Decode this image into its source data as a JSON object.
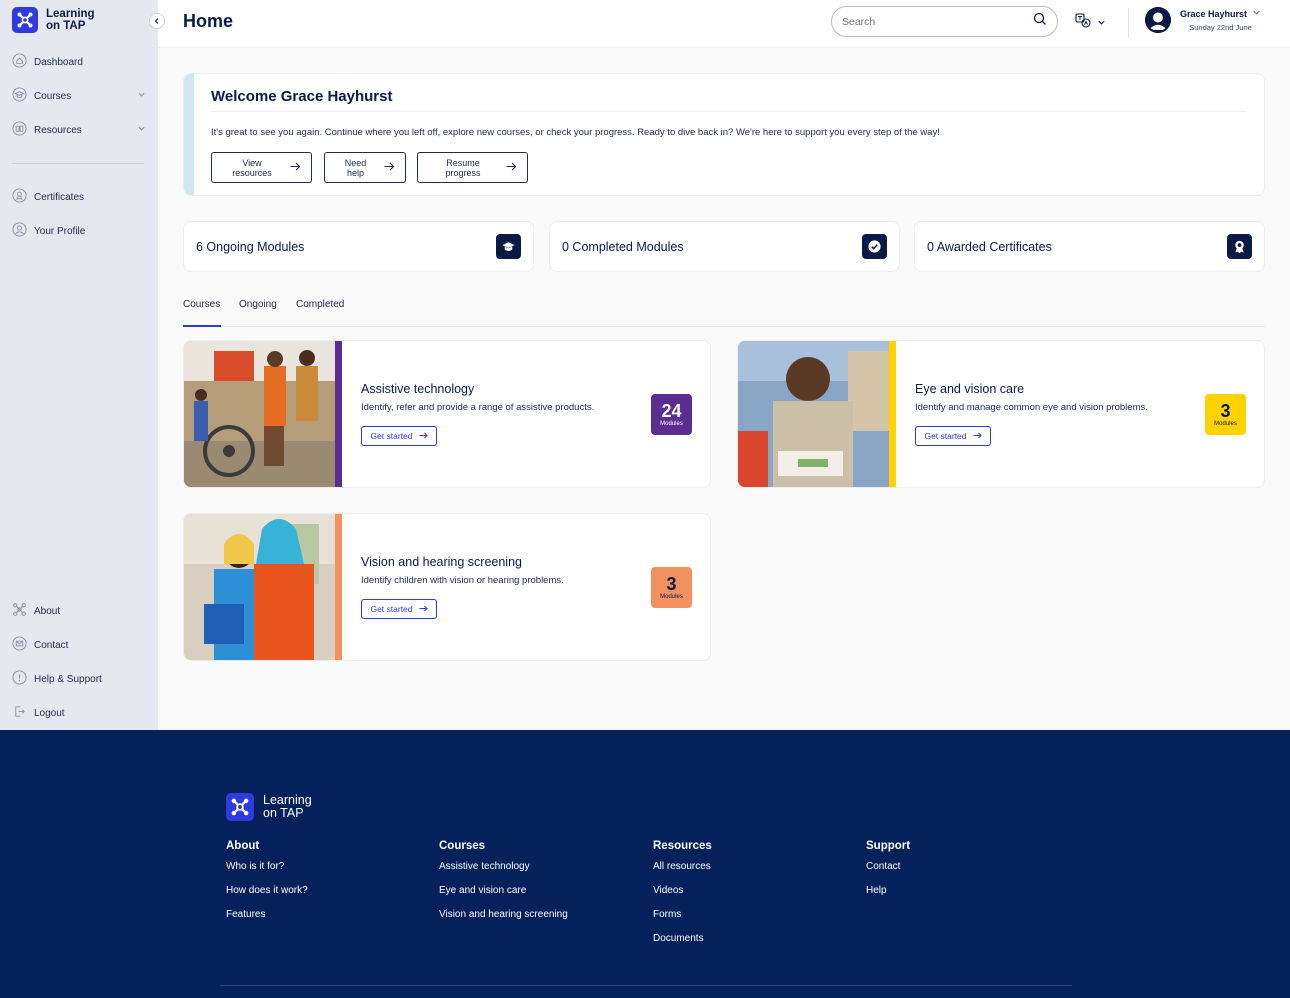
{
  "app": {
    "name_line1": "Learning",
    "name_line2": "on TAP"
  },
  "sidebar": {
    "top_items": [
      {
        "label": "Dashboard",
        "icon": "home-icon"
      },
      {
        "label": "Courses",
        "icon": "graduation-cap-icon"
      },
      {
        "label": "Resources",
        "icon": "book-icon"
      }
    ],
    "mid_items": [
      {
        "label": "Certificates",
        "icon": "award-icon"
      },
      {
        "label": "Your Profile",
        "icon": "user-circle-icon"
      }
    ],
    "bottom_items": [
      {
        "label": "About",
        "icon": "logo-icon"
      },
      {
        "label": "Contact",
        "icon": "mail-icon"
      },
      {
        "label": "Help & Support",
        "icon": "help-icon"
      },
      {
        "label": "Logout",
        "icon": "logout-icon"
      }
    ]
  },
  "header": {
    "title": "Home",
    "search_placeholder": "Search",
    "user_name": "Grace Hayhurst",
    "user_date": "Sunday 22nd June"
  },
  "welcome": {
    "title": "Welcome Grace Hayhurst",
    "message": "It's great to see you again. Continue where you left off, explore new courses, or check your progress. Ready to dive back in? We're here to support you every step of the way!",
    "buttons": [
      "View resources",
      "Need help",
      "Resume progress"
    ]
  },
  "stats": [
    {
      "label": "6 Ongoing Modules",
      "icon": "graduation-cap-icon"
    },
    {
      "label": "0 Completed Modules",
      "icon": "check-circle-icon"
    },
    {
      "label": "0 Awarded Certificates",
      "icon": "award-icon"
    }
  ],
  "tabs": [
    "Courses",
    "Ongoing",
    "Completed"
  ],
  "active_tab": "Courses",
  "courses": [
    {
      "title": "Assistive technology",
      "description": "Identify, refer and provide a range of assistive products.",
      "modules": "24",
      "modules_label": "Modules",
      "cta": "Get started",
      "accent": "#5c2d91",
      "badge_bg": "#5c2d91",
      "badge_fg": "#ffffff"
    },
    {
      "title": "Eye and vision care",
      "description": "Identify and manage common eye and vision problems.",
      "modules": "3",
      "modules_label": "Modules",
      "cta": "Get started",
      "accent": "#ffd200",
      "badge_bg": "#ffd200",
      "badge_fg": "#0b1a45"
    },
    {
      "title": "Vision and hearing screening",
      "description": "Identify children with vision or hearing problems.",
      "modules": "3",
      "modules_label": "Modules",
      "cta": "Get started",
      "accent": "#f29160",
      "badge_bg": "#f29160",
      "badge_fg": "#0b1a45"
    }
  ],
  "footer": {
    "columns": [
      {
        "heading": "About",
        "links": [
          "Who is it for?",
          "How does it work?",
          "Features"
        ]
      },
      {
        "heading": "Courses",
        "links": [
          "Assistive technology",
          "Eye and vision care",
          "Vision and hearing screening"
        ]
      },
      {
        "heading": "Resources",
        "links": [
          "All resources",
          "Videos",
          "Forms",
          "Documents"
        ]
      },
      {
        "heading": "Support",
        "links": [
          "Contact",
          "Help"
        ]
      }
    ]
  },
  "colors": {
    "brand": "#2f3bdc",
    "navy": "#0b1a45",
    "footer_bg": "#04215c",
    "sidebar_bg": "#e6e8ef"
  }
}
